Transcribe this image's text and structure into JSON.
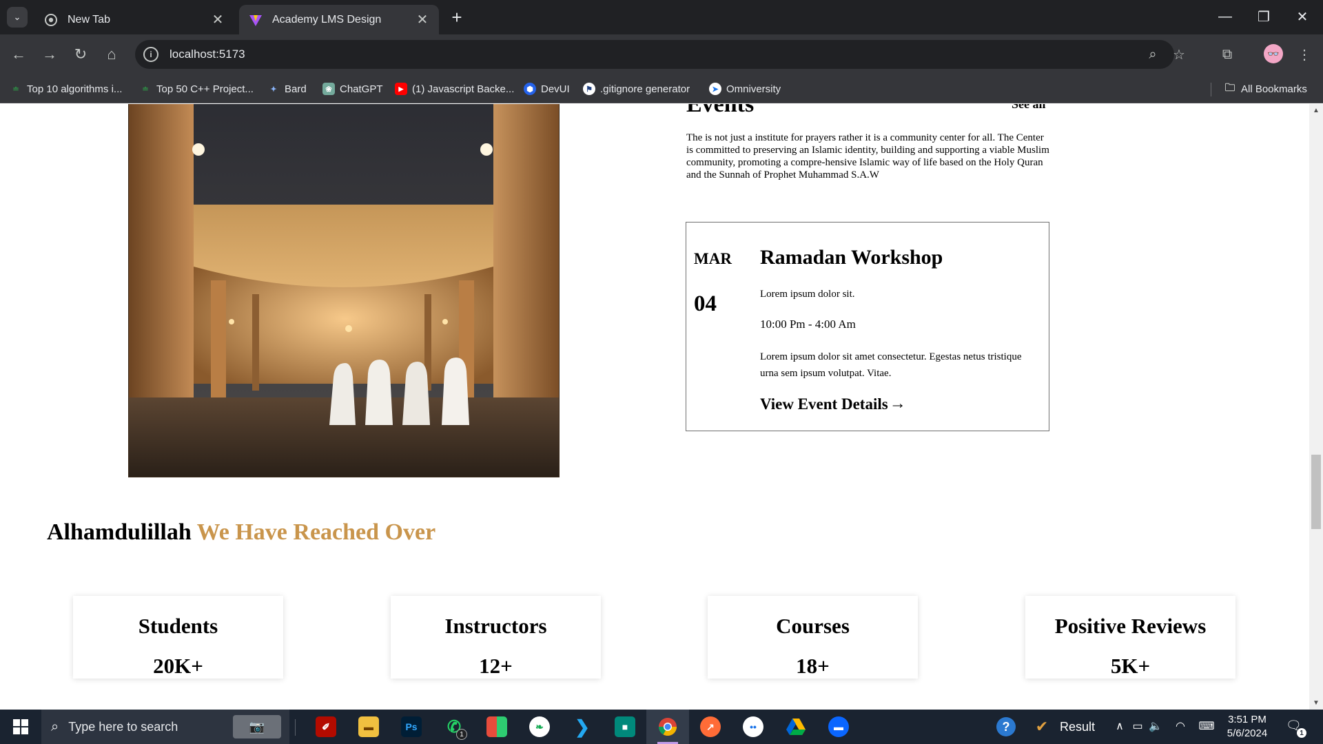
{
  "browser": {
    "tabs": [
      {
        "title": "New Tab",
        "icon": "chrome-icon",
        "active": false
      },
      {
        "title": "Academy LMS Design",
        "icon": "vite-icon",
        "active": true
      }
    ],
    "url": "localhost:5173",
    "bookmarks": [
      {
        "label": "Top 10 algorithms i...",
        "icon": "gfg-icon",
        "color": "#2f8d46"
      },
      {
        "label": "Top 50 C++ Project...",
        "icon": "gfg-icon",
        "color": "#2f8d46"
      },
      {
        "label": "Bard",
        "icon": "bard-icon",
        "color": "#8ab4f8"
      },
      {
        "label": "ChatGPT",
        "icon": "chatgpt-icon",
        "color": "#74aa9c"
      },
      {
        "label": "(1) Javascript Backe...",
        "icon": "youtube-icon",
        "color": "#ff0000"
      },
      {
        "label": "DevUI",
        "icon": "devui-icon",
        "color": "#2563eb"
      },
      {
        "label": ".gitignore generator",
        "icon": "gitignore-icon",
        "color": "#ffffff"
      },
      {
        "label": "Omniversity",
        "icon": "omniversity-icon",
        "color": "#ffffff"
      }
    ],
    "all_bookmarks": "All Bookmarks"
  },
  "page": {
    "events": {
      "title": "Events",
      "see_all": "See all",
      "description": "The is not just a institute for prayers rather it is a community center for all. The Center is committed to preserving an Islamic identity, building and supporting a viable Muslim community, promoting a compre-hensive Islamic way of life based on the Holy Quran and the Sunnah of Prophet Muhammad S.A.W",
      "card": {
        "month": "MAR",
        "day": "04",
        "title": "Ramadan Workshop",
        "subtitle": "Lorem ipsum dolor sit.",
        "time": "10:00 Pm - 4:00 Am",
        "text": "Lorem ipsum dolor sit amet consectetur. Egestas netus tristique urna sem ipsum volutpat. Vitae.",
        "link": "View Event Details",
        "link_arrow": "→"
      }
    },
    "reach": {
      "heading_main": "Alhamdulillah",
      "heading_accent": "We Have Reached Over",
      "accent_color": "#c9954c",
      "stats": [
        {
          "label": "Students",
          "value": "20K+"
        },
        {
          "label": "Instructors",
          "value": "12+"
        },
        {
          "label": "Courses",
          "value": "18+"
        },
        {
          "label": "Positive Reviews",
          "value": "5K+"
        }
      ]
    }
  },
  "taskbar": {
    "search_placeholder": "Type here to search",
    "whatsapp_badge": "1",
    "result_label": "Result",
    "time": "3:51 PM",
    "date": "5/6/2024",
    "notification_count": "1"
  }
}
